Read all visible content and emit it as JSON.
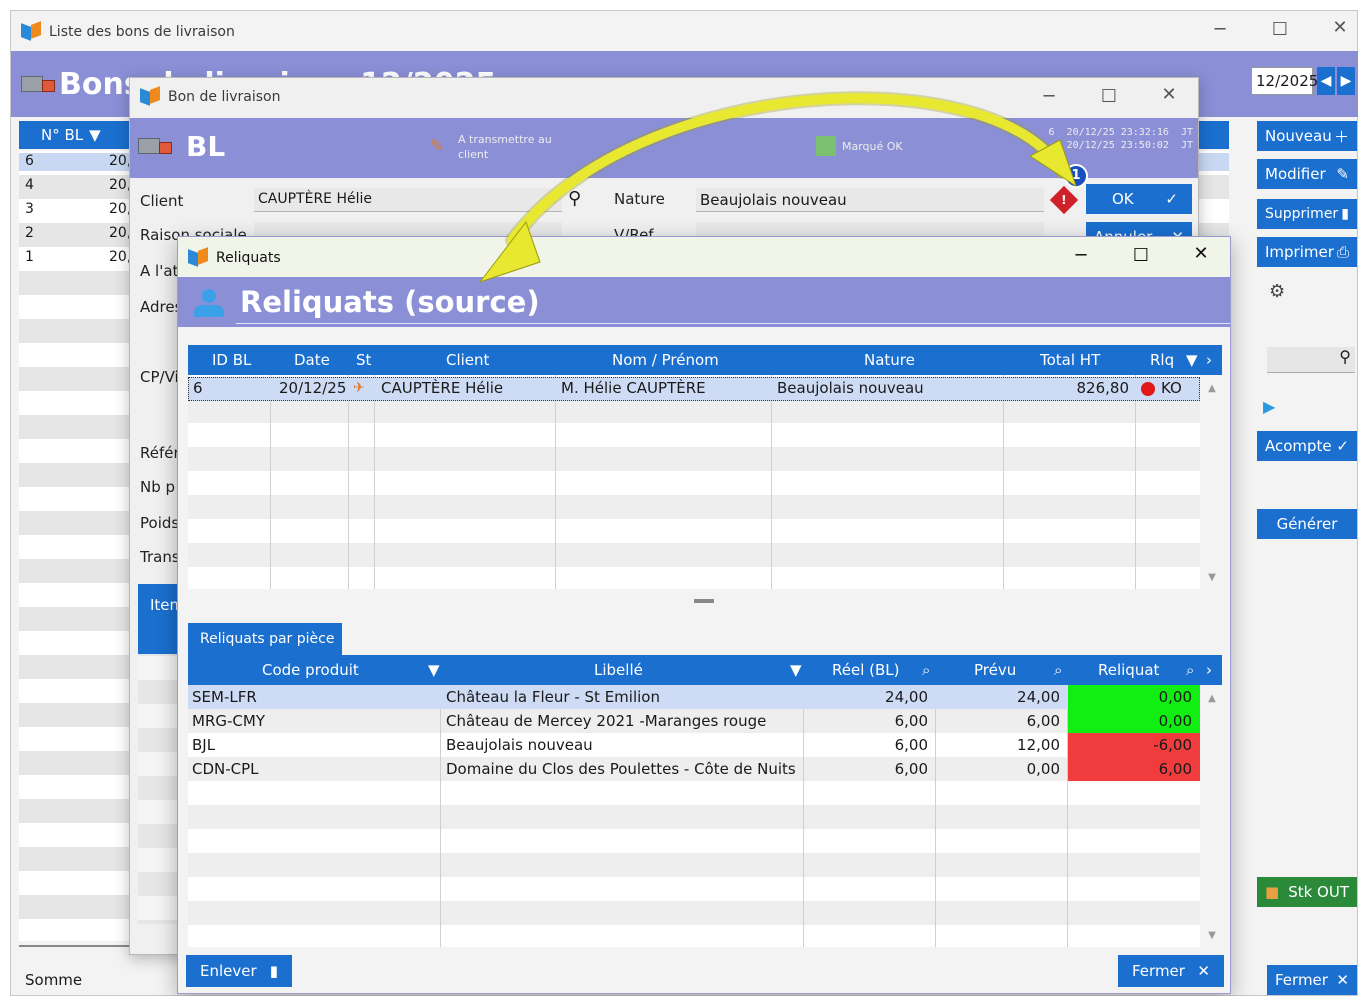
{
  "main_window": {
    "title": "Liste des bons de livraison",
    "header_title": "Bons de livraison 12/2025",
    "period": "12/2025",
    "grid_headers": [
      "N° BL",
      ""
    ],
    "rows": [
      {
        "num": "6",
        "date": "20,"
      },
      {
        "num": "4",
        "date": "20,"
      },
      {
        "num": "3",
        "date": "20,"
      },
      {
        "num": "2",
        "date": "20,"
      },
      {
        "num": "1",
        "date": "20,"
      }
    ],
    "footer_label": "Somme",
    "buttons": {
      "nouveau": "Nouveau",
      "modifier": "Modifier",
      "supprimer": "Supprimer",
      "imprimer": "Imprimer",
      "acompte": "Acompte",
      "generer": "Générer",
      "stk_out": "Stk OUT",
      "fermer": "Fermer"
    }
  },
  "bl_window": {
    "title": "Bon de livraison",
    "header": "BL",
    "status_text": "A transmettre au client",
    "marque_ok": "Marqué OK",
    "meta": "6  20/12/25 23:32:16  JT\n20/12/25 23:50:02  JT",
    "labels": {
      "client": "Client",
      "raison_sociale": "Raison sociale",
      "a_lattention": "A l'att",
      "adresse": "Adres",
      "cp_ville": "CP/Vi",
      "reference": "Référ",
      "nb_pieces": "Nb p",
      "poids": "Poids",
      "transport": "Trans",
      "nature": "Nature",
      "vref": "V/Ref",
      "item": "Item"
    },
    "client_value": "CAUPTÈRE Hélie",
    "nature_value": "Beaujolais nouveau",
    "ok_label": "OK",
    "annuler_label": "Annuler",
    "badge": "1"
  },
  "reliquats_window": {
    "title": "Reliquats",
    "header": "Reliquats (source)",
    "top_grid": {
      "headers": [
        "ID BL",
        "Date",
        "St",
        "Client",
        "Nom / Prénom",
        "Nature",
        "Total HT",
        "Rlq"
      ],
      "rows": [
        {
          "id": "6",
          "date": "20/12/25",
          "client": "CAUPTÈRE Hélie",
          "nom": "M. Hélie CAUPTÈRE",
          "nature": "Beaujolais nouveau",
          "total": "826,80",
          "rlq": "KO"
        }
      ]
    },
    "tab_label": "Reliquats par pièce",
    "bottom_grid": {
      "headers": [
        "Code produit",
        "Libellé",
        "Réel (BL)",
        "Prévu",
        "Reliquat"
      ],
      "rows": [
        {
          "code": "SEM-LFR",
          "libelle": "Château la Fleur - St Emilion",
          "reel": "24,00",
          "prevu": "24,00",
          "reliquat": "0,00",
          "status": "ok"
        },
        {
          "code": "MRG-CMY",
          "libelle": "Château de Mercey 2021 -Maranges rouge",
          "reel": "6,00",
          "prevu": "6,00",
          "reliquat": "0,00",
          "status": "ok"
        },
        {
          "code": "BJL",
          "libelle": "Beaujolais nouveau",
          "reel": "6,00",
          "prevu": "12,00",
          "reliquat": "-6,00",
          "status": "ko"
        },
        {
          "code": "CDN-CPL",
          "libelle": "Domaine du Clos des Poulettes - Côte de Nuits Villa",
          "reel": "6,00",
          "prevu": "0,00",
          "reliquat": "6,00",
          "status": "ko"
        }
      ]
    },
    "enlever_label": "Enlever",
    "fermer_label": "Fermer"
  },
  "colors": {
    "accent": "#1a6fcf",
    "band": "#8a8fd6",
    "ok_green": "#11ee11",
    "ko_red": "#f03c3c",
    "arrow_yellow": "#e8e830"
  }
}
